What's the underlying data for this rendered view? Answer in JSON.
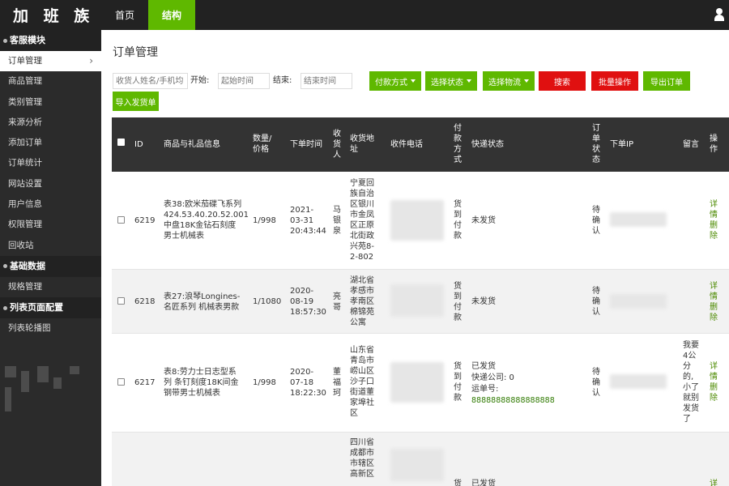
{
  "app": {
    "logo": "加 班 族"
  },
  "topnav": [
    {
      "label": "首页"
    },
    {
      "label": "结构"
    }
  ],
  "sidebar": {
    "groups": [
      {
        "label": "客服模块",
        "items": [
          "订单管理",
          "商品管理",
          "类别管理",
          "来源分析",
          "添加订单",
          "订单统计",
          "网站设置",
          "用户信息",
          "权限管理",
          "回收站"
        ]
      },
      {
        "label": "基础数据",
        "items": [
          "规格管理"
        ]
      },
      {
        "label": "列表页面配置",
        "items": [
          "列表轮播图"
        ]
      }
    ],
    "active_item": "订单管理"
  },
  "page": {
    "title": "订单管理"
  },
  "filters": {
    "search_placeholder": "收货人姓名/手机均",
    "start_label": "开始:",
    "start_placeholder": "起始时间",
    "end_label": "结束:",
    "end_placeholder": "结束时间",
    "pay_method": "付款方式",
    "status": "选择状态",
    "logistics": "选择物流",
    "search": "搜索",
    "batch": "批量操作",
    "export": "导出订单",
    "import": "导入发货单"
  },
  "table": {
    "headers": {
      "id": "ID",
      "product": "商品与礼品信息",
      "qty": "数量/\n价格",
      "time": "下单时间",
      "recipient": "收\n货\n人",
      "address": "收货地\n址",
      "phone": "收件电话",
      "pay": "付\n款\n方\n式",
      "express": "快递状态",
      "order_status": "订\n单\n状\n态",
      "ip": "下单IP",
      "note": "留言",
      "op": "操\n作"
    },
    "rows": [
      {
        "id": "6219",
        "product": "表38:欧米茄碟飞系列\n424.53.40.20.52.001\n中盘18K金钻石刻度\n男士机械表",
        "qty": "1/998",
        "time": "2021-\n03-31\n20:43:44",
        "recipient": "马\n银\n泉",
        "address": "宁夏回\n族自治\n区银川\n市金凤\n区正原\n北街政\n兴苑8-\n2-802",
        "pay": "货\n到\n付\n款",
        "express": "未发货",
        "status": "待\n确\n认",
        "note": "",
        "op_detail": "详\n情",
        "op_delete": "删\n除"
      },
      {
        "id": "6218",
        "product": "表27:浪琴Longines-\n名匠系列 机械表男款",
        "qty": "1/1080",
        "time": "2020-\n08-19\n18:57:30",
        "recipient": "亮\n哥",
        "address": "湖北省\n孝感市\n孝南区\n棉锦苑\n公寓",
        "pay": "货\n到\n付\n款",
        "express": "未发货",
        "status": "待\n确\n认",
        "note": "",
        "op_detail": "详\n情",
        "op_delete": "删\n除"
      },
      {
        "id": "6217",
        "product": "表8:劳力士日志型系\n列 条钉刻度18K间金\n钢带男士机械表",
        "qty": "1/998",
        "time": "2020-\n07-18\n18:22:30",
        "recipient": "董\n福\n珂",
        "address": "山东省\n青岛市\n崂山区\n沙子口\n街道董\n家埠社\n区",
        "pay": "货\n到\n付\n款",
        "express_status": "已发货",
        "express_company": "快递公司: 0",
        "express_no_label": "运单号:",
        "express_no": "88888888888888888",
        "status": "待\n确\n认",
        "note": "我要\n4公\n分\n的,\n小了\n就别\n发货\n了",
        "op_detail": "详\n情",
        "op_delete": "删\n除"
      },
      {
        "address": "四川省\n成都市\n市辖区\n高新区",
        "pay": "货",
        "express": "已发货",
        "op": "详"
      }
    ]
  }
}
